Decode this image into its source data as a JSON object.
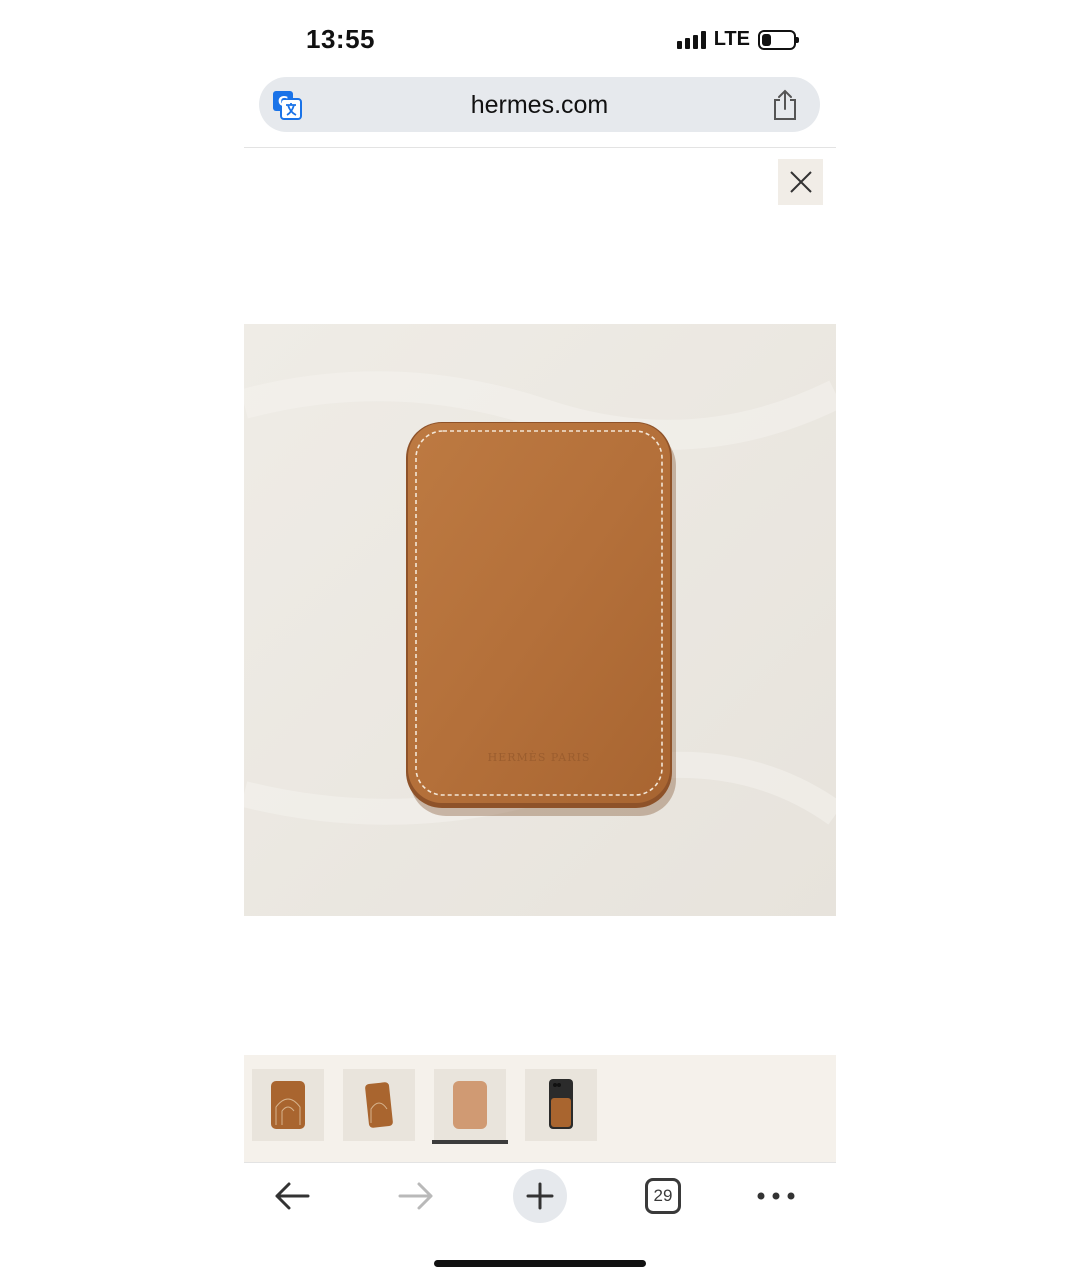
{
  "status": {
    "time": "13:55",
    "network": "LTE",
    "battery_level": 0.3
  },
  "browser": {
    "url": "hermes.com",
    "tabs_count": "29"
  },
  "gallery": {
    "thumbnail_count": 4,
    "selected_index": 2,
    "thumbnails": [
      {
        "name": "front-view"
      },
      {
        "name": "angled-view"
      },
      {
        "name": "back-view"
      },
      {
        "name": "on-phone-view"
      }
    ]
  },
  "product": {
    "leather_color": "#b4703a",
    "background_color": "#ece9e3"
  },
  "icons": {
    "translate": "translate-icon",
    "share": "share-icon",
    "close": "close-icon",
    "back": "back-arrow-icon",
    "forward": "forward-arrow-icon",
    "new_tab": "plus-icon",
    "tabs": "tabs-icon",
    "more": "more-icon"
  }
}
